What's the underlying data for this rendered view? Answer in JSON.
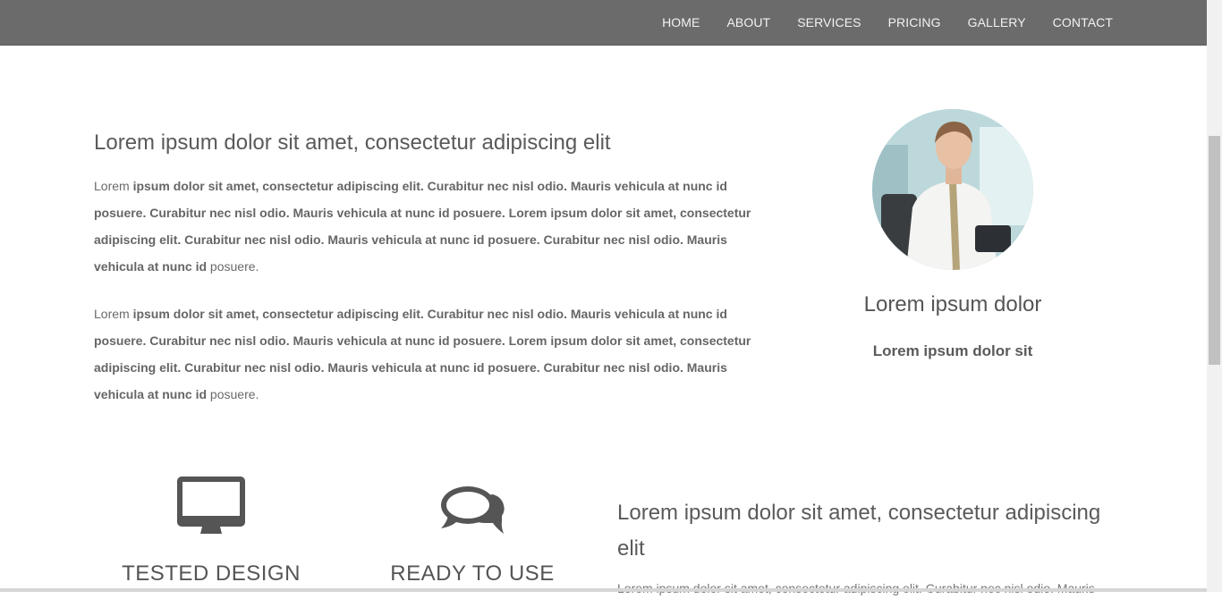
{
  "nav": {
    "items": [
      "HOME",
      "ABOUT",
      "SERVICES",
      "PRICING",
      "GALLERY",
      "CONTACT"
    ]
  },
  "about": {
    "title": "Lorem ipsum dolor sit amet, consectetur adipiscing elit",
    "paragraph_1": {
      "plain": "Lorem ",
      "bold_1": "ipsum dolor sit amet, consectetur adipiscing elit. Curabitur nec nisl odio. Mauris vehicula at nunc id posuere. Curabitur nec nisl odio. Mauris vehicula at nunc id posuere. Lorem ipsum dolor sit amet, consectetur adipiscing elit. Curabitur nec nisl odio. Mauris vehicula at nunc id posuere. Curabitur nec nisl odio. Mauris vehicula at nunc id",
      "tail": " posuere."
    },
    "paragraph_2": {
      "plain": "Lorem ",
      "bold_1": "ipsum dolor sit amet, consectetur adipiscing elit. Curabitur nec nisl odio. Mauris vehicula at nunc id posuere. Curabitur nec nisl odio. Mauris vehicula at nunc id posuere. Lorem ipsum dolor sit amet, consectetur adipiscing elit. Curabitur nec nisl odio. Mauris vehicula at nunc id posuere. Curabitur nec nisl odio. Mauris vehicula at nunc id",
      "tail": " posuere."
    }
  },
  "profile": {
    "name": "Lorem ipsum dolor",
    "role": "Lorem ipsum dolor sit"
  },
  "features": [
    {
      "icon": "desktop-icon",
      "title": "TESTED DESIGN"
    },
    {
      "icon": "comments-icon",
      "title": "READY TO USE"
    }
  ],
  "side": {
    "title": "Lorem ipsum dolor sit amet, consectetur adipiscing elit",
    "text": "Lorem ipsum dolor sit amet, consectetur adipiscing elit. Curabitur nec nisl odio. Mauris"
  },
  "colors": {
    "navbar": "#6b6b6b",
    "nav_text": "#f2f2f2",
    "heading_text": "#555555",
    "body_text": "#6a6a6a",
    "icon": "#555555"
  }
}
